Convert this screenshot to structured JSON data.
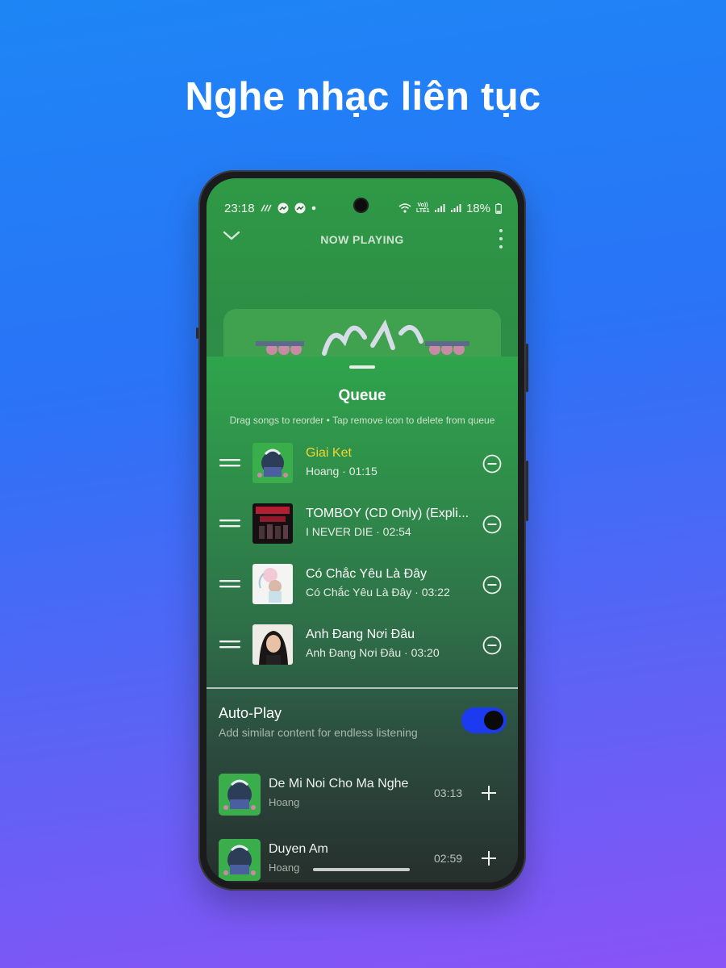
{
  "headline": "Nghe nhạc liên tục",
  "status_bar": {
    "time": "23:18",
    "battery": "18%",
    "network_label": "Vo)) LTE1"
  },
  "now_playing": {
    "title": "NOW PLAYING"
  },
  "queue": {
    "title": "Queue",
    "hint": "Drag songs to reorder • Tap remove icon to delete from queue",
    "items": [
      {
        "title": "Giai Ket",
        "subtitle": "Hoang · 01:15",
        "active": true,
        "thumb": "green-hoang"
      },
      {
        "title": "TOMBOY (CD Only) (Expli...",
        "subtitle": "I NEVER DIE · 02:54",
        "active": false,
        "thumb": "red-dark"
      },
      {
        "title": "Có Chắc Yêu Là Đây",
        "subtitle": "Có Chắc Yêu Là Đây · 03:22",
        "active": false,
        "thumb": "pastel"
      },
      {
        "title": "Anh Đang Nơi Đâu",
        "subtitle": "Anh Đang Nơi Đâu · 03:20",
        "active": false,
        "thumb": "portrait"
      }
    ]
  },
  "autoplay": {
    "title": "Auto-Play",
    "subtitle": "Add similar content for endless listening",
    "enabled": true,
    "accent_color": "#1c3af0"
  },
  "suggestions": [
    {
      "title": "De Mi Noi Cho Ma Nghe",
      "artist": "Hoang",
      "duration": "03:13"
    },
    {
      "title": "Duyen Am",
      "artist": "Hoang",
      "duration": "02:59"
    }
  ],
  "icons": [
    "chevron-down-icon",
    "more-vert-icon",
    "drag-handle-icon",
    "remove-circle-icon",
    "add-icon",
    "wifi-icon",
    "signal-icon",
    "battery-icon",
    "messenger-icon",
    "camera-cutout"
  ],
  "colors": {
    "active_track": "#f3d430",
    "background_top": "#1d86f5",
    "background_bottom": "#8a53f6",
    "sheet_green": "#2fa44c"
  }
}
